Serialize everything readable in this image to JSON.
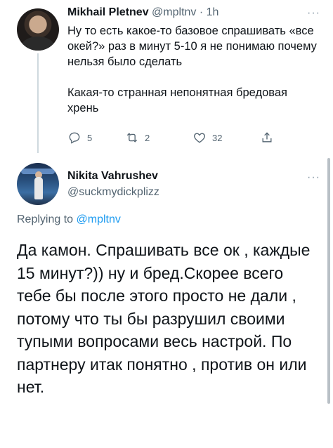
{
  "original_tweet": {
    "author_name": "Mikhail Pletnev",
    "handle": "@mpltnv",
    "separator": " · ",
    "time": "1h",
    "more_icon": "···",
    "paragraph_1": "Ну то есть какое-то базовое спрашивать «все окей?» раз в минут 5-10 я не понимаю почему нельзя было сделать",
    "paragraph_2": "Какая-то странная непонятная бредовая хрень",
    "actions": {
      "reply_icon": "reply-icon",
      "reply_count": "5",
      "retweet_icon": "retweet-icon",
      "retweet_count": "2",
      "like_icon": "heart-icon",
      "like_count": "32",
      "share_icon": "share-icon"
    }
  },
  "reply_tweet": {
    "author_name": "Nikita Vahrushev",
    "handle": "@suckmydickplizz",
    "more_icon": "···",
    "replying_prefix": "Replying to ",
    "replying_mention": "@mpltnv",
    "text": "Да камон. Спрашивать все ок , каждые 15 минут?)) ну и бред.Скорее всего тебе бы после этого просто не дали , потому что ты бы разрушил своими тупыми вопросами весь настрой. По партнеру итак понятно , против он или нет."
  },
  "colors": {
    "text": "#0f1419",
    "secondary": "#536471",
    "accent": "#1d9bf0",
    "thread_line": "#cfd9de"
  }
}
